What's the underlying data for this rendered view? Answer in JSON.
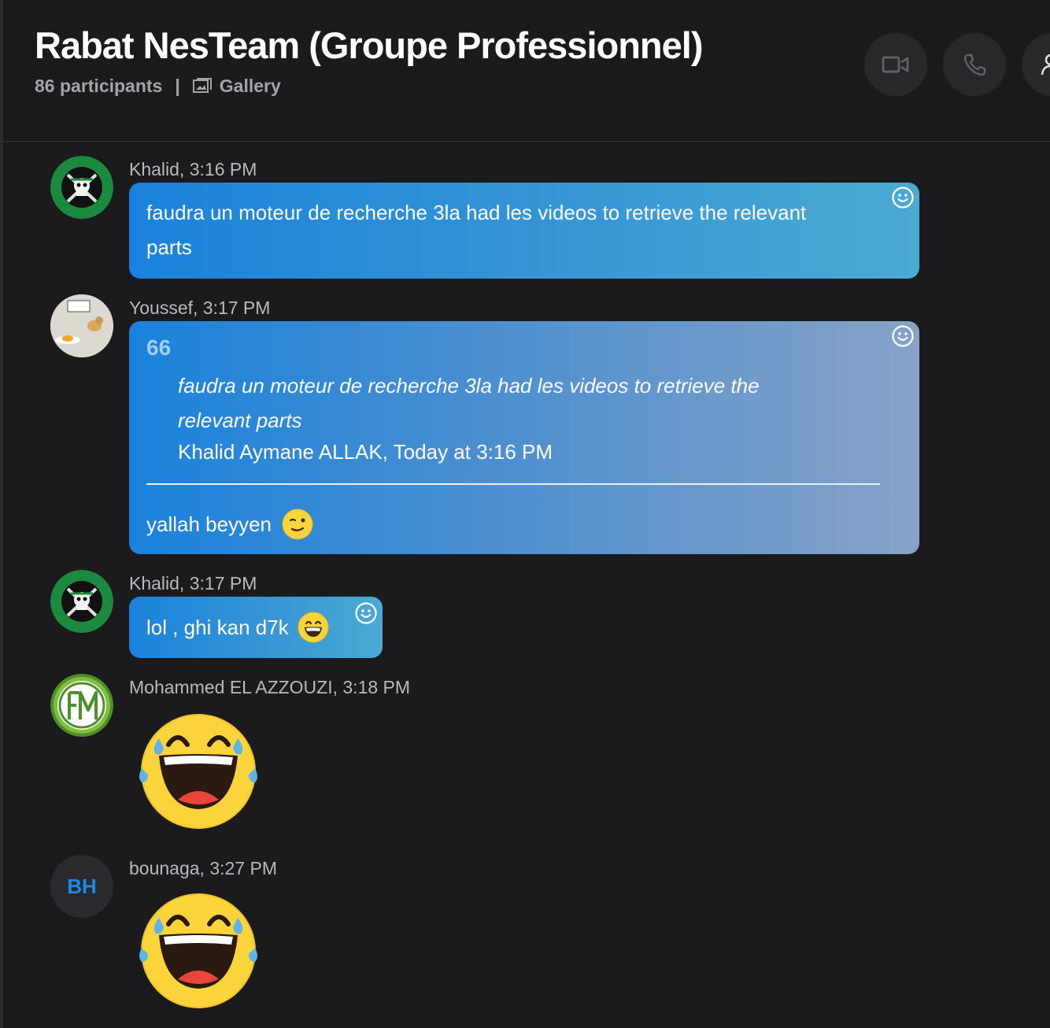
{
  "header": {
    "title": "Rabat NesTeam (Groupe Professionnel)",
    "participants": "86 participants",
    "separator": "|",
    "gallery_label": "Gallery"
  },
  "header_buttons": [
    "video-call-icon",
    "audio-call-icon",
    "add-participant-icon"
  ],
  "messages": [
    {
      "meta": "Khalid, 3:16 PM",
      "text_line1": "faudra un moteur de recherche 3la had les videos to retrieve the relevant",
      "text_line2": "parts",
      "avatar": "zoro-logo"
    },
    {
      "meta": "Youssef, 3:17 PM",
      "avatar": "chick-egg-photo",
      "quote": {
        "mark": "66",
        "text_line1": "faudra un moteur de recherche 3la had les videos to retrieve the",
        "text_line2": "relevant parts",
        "author": "Khalid Aymane ALLAK, Today at 3:16 PM"
      },
      "reply": "yallah beyyen",
      "reply_emoji": "wink-emoji"
    },
    {
      "meta": "Khalid, 3:17 PM",
      "text": "lol , ghi kan d7k",
      "emoji": "grin-emoji",
      "avatar": "zoro-logo"
    },
    {
      "meta": "Mohammed EL AZZOUZI, 3:18 PM",
      "avatar": "fm-logo",
      "sticker": "laughing-tears-emoji"
    },
    {
      "meta": "bounaga, 3:27 PM",
      "avatar_initials": "BH",
      "sticker": "laughing-tears-emoji"
    }
  ],
  "colors": {
    "background": "#1b1b1d",
    "bubble_start": "#1a82dc",
    "bubble_end": "#4aaad2",
    "initials": "#1e88e5"
  }
}
